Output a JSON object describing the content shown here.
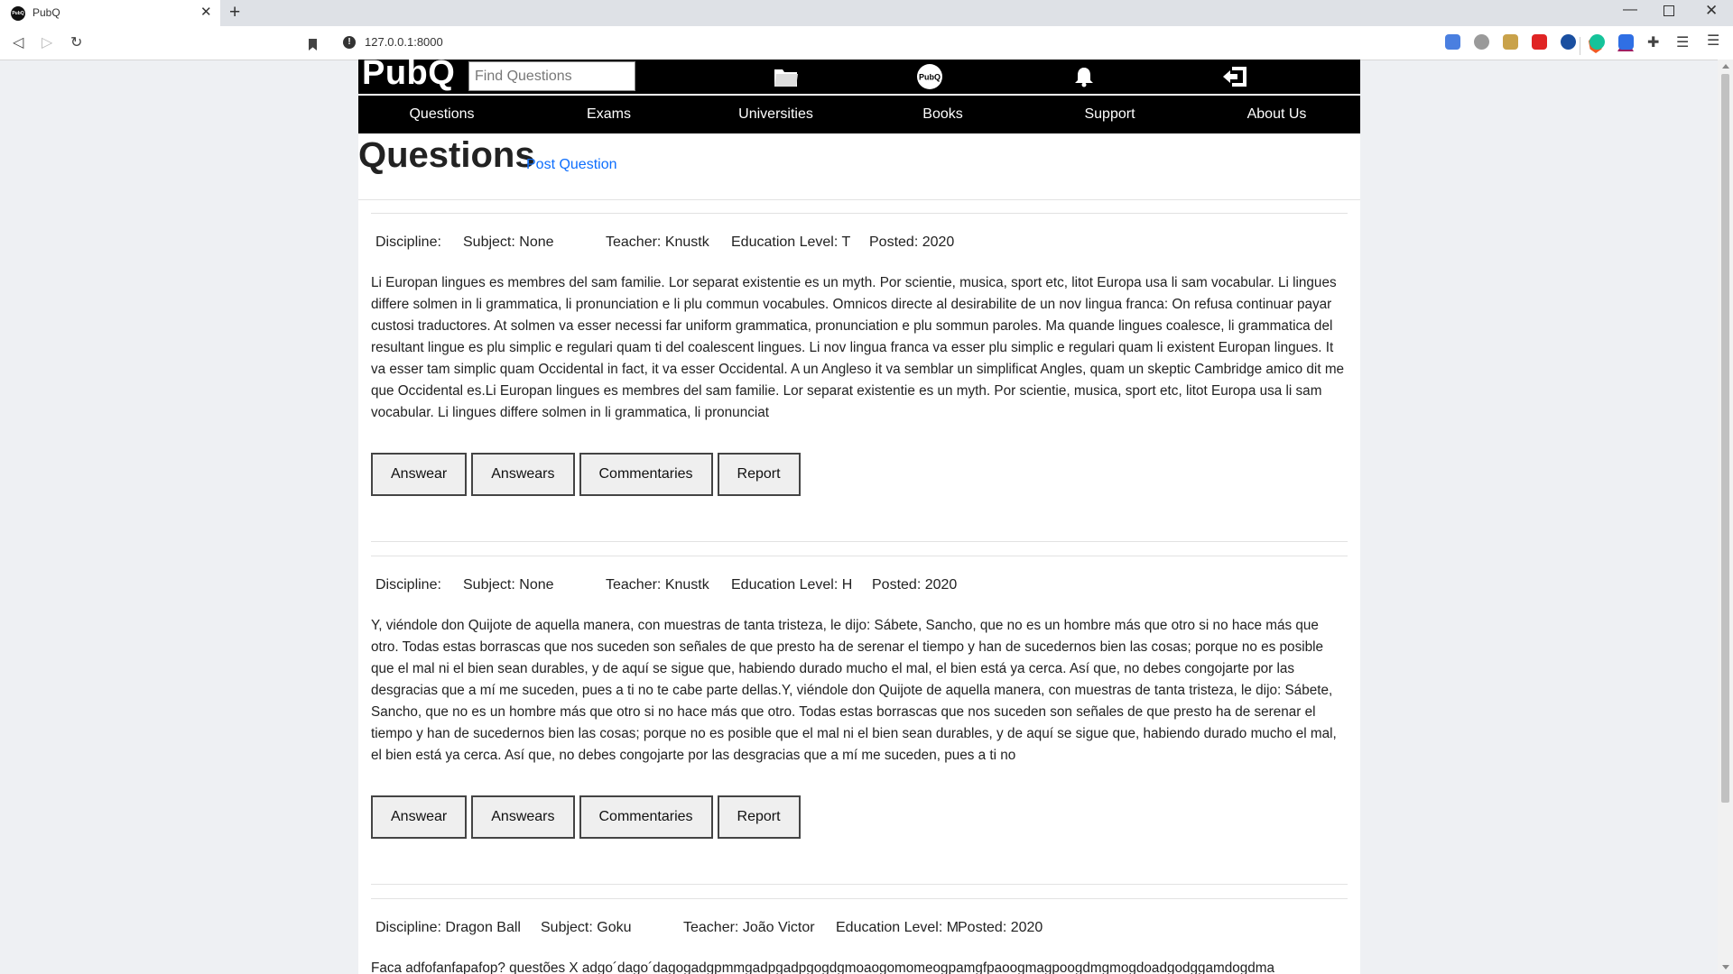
{
  "browser": {
    "tab_title": "PubQ",
    "tab_favicon_text": "PubQ",
    "url": "127.0.0.1:8000"
  },
  "header": {
    "logo": "PubQ",
    "search_placeholder": "Find Questions",
    "center_logo_text": "PubQ"
  },
  "nav": [
    "Questions",
    "Exams",
    "Universities",
    "Books",
    "Support",
    "About Us"
  ],
  "page": {
    "title": "Questions",
    "post_link": "Post Question"
  },
  "questions": [
    {
      "discipline": "Discipline: ",
      "subject": "Subject: None",
      "teacher": "Teacher: Knustk",
      "education": "Education Level: T",
      "posted": "Posted: 2020",
      "text": "Li Europan lingues es membres del sam familie. Lor separat existentie es un myth. Por scientie, musica, sport etc, litot Europa usa li sam vocabular. Li lingues differe solmen in li grammatica, li pronunciation e li plu commun vocabules. Omnicos directe al desirabilite de un nov lingua franca: On refusa continuar payar custosi traductores. At solmen va esser necessi far uniform grammatica, pronunciation e plu sommun paroles. Ma quande lingues coalesce, li grammatica del resultant lingue es plu simplic e regulari quam ti del coalescent lingues. Li nov lingua franca va esser plu simplic e regulari quam li existent Europan lingues. It va esser tam simplic quam Occidental in fact, it va esser Occidental. A un Angleso it va semblar un simplificat Angles, quam un skeptic Cambridge amico dit me que Occidental es.Li Europan lingues es membres del sam familie. Lor separat existentie es un myth. Por scientie, musica, sport etc, litot Europa usa li sam vocabular. Li lingues differe solmen in li grammatica, li pronunciat"
    },
    {
      "discipline": "Discipline: ",
      "subject": "Subject: None",
      "teacher": "Teacher: Knustk",
      "education": "Education Level: H",
      "posted": "Posted: 2020",
      "text": "Y, viéndole don Quijote de aquella manera, con muestras de tanta tristeza, le dijo: Sábete, Sancho, que no es un hombre más que otro si no hace más que otro. Todas estas borrascas que nos suceden son señales de que presto ha de serenar el tiempo y han de sucedernos bien las cosas; porque no es posible que el mal ni el bien sean durables, y de aquí se sigue que, habiendo durado mucho el mal, el bien está ya cerca. Así que, no debes congojarte por las desgracias que a mí me suceden, pues a ti no te cabe parte dellas.Y, viéndole don Quijote de aquella manera, con muestras de tanta tristeza, le dijo: Sábete, Sancho, que no es un hombre más que otro si no hace más que otro. Todas estas borrascas que nos suceden son señales de que presto ha de serenar el tiempo y han de sucedernos bien las cosas; porque no es posible que el mal ni el bien sean durables, y de aquí se sigue que, habiendo durado mucho el mal, el bien está ya cerca. Así que, no debes congojarte por las desgracias que a mí me suceden, pues a ti no"
    },
    {
      "discipline": "Discipline: Dragon Ball",
      "subject": "Subject: Goku",
      "teacher": "Teacher: João Victor",
      "education": "Education Level: M",
      "posted": "Posted: 2020",
      "text": "Faca adfofanfapafop? questões X adgo´dago´dagogadgpmmgadpgadpgogdgmoaogomomeogpamgfpaoogmagpoogdmgmogdoadgodggamdogdma"
    }
  ],
  "buttons": {
    "answer": "Answear",
    "answers": "Answears",
    "commentaries": "Commentaries",
    "report": "Report"
  }
}
